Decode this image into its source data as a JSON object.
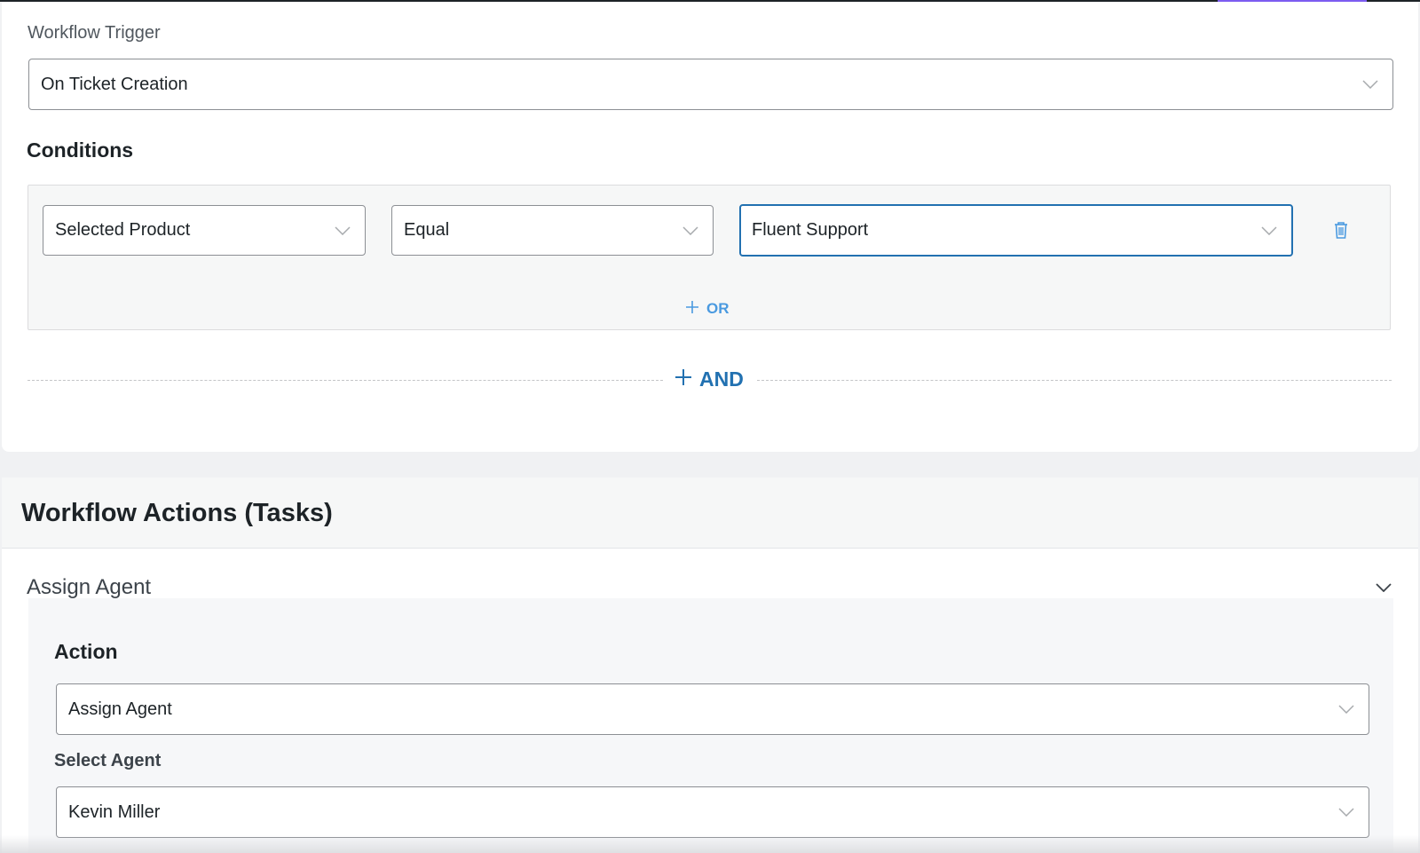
{
  "trigger": {
    "label": "Workflow Trigger",
    "value": "On Ticket Creation"
  },
  "conditions": {
    "heading": "Conditions",
    "field": "Selected Product",
    "operator": "Equal",
    "value": "Fluent Support",
    "or_label": "OR",
    "and_label": "AND"
  },
  "actions_section": {
    "title": "Workflow Actions (Tasks)"
  },
  "task": {
    "title": "Assign Agent",
    "action_heading": "Action",
    "action_value": "Assign Agent",
    "agent_label": "Select Agent",
    "agent_value": "Kevin Miller"
  },
  "colors": {
    "accent": "#2271b1",
    "or_link": "#4a9ae0",
    "tab_indicator": "#7c5cf0"
  }
}
